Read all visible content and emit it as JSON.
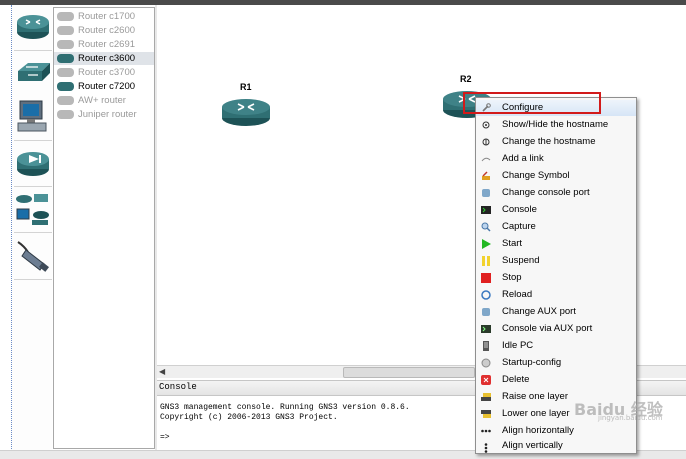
{
  "colors": {
    "router_teal": "#2f6f73",
    "menu_highlight_border": "#d21a1a",
    "disabled_text": "#9a9a9a"
  },
  "toolbar": {
    "categories": [
      {
        "icon": "router-category-icon"
      },
      {
        "icon": "switch-category-icon"
      },
      {
        "icon": "end-device-category-icon"
      },
      {
        "icon": "security-device-category-icon"
      },
      {
        "icon": "all-devices-category-icon"
      },
      {
        "icon": "cable-connect-icon"
      }
    ]
  },
  "node_list": [
    {
      "label": "Router c1700",
      "enabled": false
    },
    {
      "label": "Router c2600",
      "enabled": false
    },
    {
      "label": "Router c2691",
      "enabled": false
    },
    {
      "label": "Router c3600",
      "enabled": true,
      "selected": true
    },
    {
      "label": "Router c3700",
      "enabled": false
    },
    {
      "label": "Router c7200",
      "enabled": true
    },
    {
      "label": "AW+ router",
      "enabled": false
    },
    {
      "label": "Juniper router",
      "enabled": false
    }
  ],
  "canvas": {
    "nodes": [
      {
        "label": "R1"
      },
      {
        "label": "R2"
      }
    ]
  },
  "context_menu": {
    "items": [
      {
        "label": "Configure",
        "icon": "wrench-icon",
        "highlighted": true
      },
      {
        "label": "Show/Hide the hostname",
        "icon": "hostname-toggle-icon"
      },
      {
        "label": "Change the hostname",
        "icon": "hostname-edit-icon"
      },
      {
        "label": "Add a link",
        "icon": "link-icon"
      },
      {
        "label": "Change Symbol",
        "icon": "symbol-icon"
      },
      {
        "label": "Change console port",
        "icon": "console-port-icon"
      },
      {
        "label": "Console",
        "icon": "terminal-icon"
      },
      {
        "label": "Capture",
        "icon": "magnifier-icon"
      },
      {
        "label": "Start",
        "icon": "play-icon"
      },
      {
        "label": "Suspend",
        "icon": "pause-icon"
      },
      {
        "label": "Stop",
        "icon": "stop-icon"
      },
      {
        "label": "Reload",
        "icon": "reload-icon"
      },
      {
        "label": "Change AUX port",
        "icon": "aux-port-icon"
      },
      {
        "label": "Console via AUX port",
        "icon": "aux-terminal-icon"
      },
      {
        "label": "Idle PC",
        "icon": "idle-pc-icon"
      },
      {
        "label": "Startup-config",
        "icon": "startup-config-icon"
      },
      {
        "label": "Delete",
        "icon": "delete-icon"
      },
      {
        "label": "Raise one layer",
        "icon": "raise-layer-icon"
      },
      {
        "label": "Lower one layer",
        "icon": "lower-layer-icon"
      },
      {
        "label": "Align horizontally",
        "icon": "align-horizontal-icon"
      },
      {
        "label": "Align vertically",
        "icon": "align-vertical-icon"
      }
    ]
  },
  "console": {
    "title": "Console",
    "lines": [
      "GNS3 management console. Running GNS3 version 0.8.6.",
      "Copyright (c) 2006-2013 GNS3 Project.",
      "",
      "=>"
    ]
  },
  "watermark": {
    "text": "Baidu 经验",
    "sub": "jingyan.baidu.com"
  }
}
